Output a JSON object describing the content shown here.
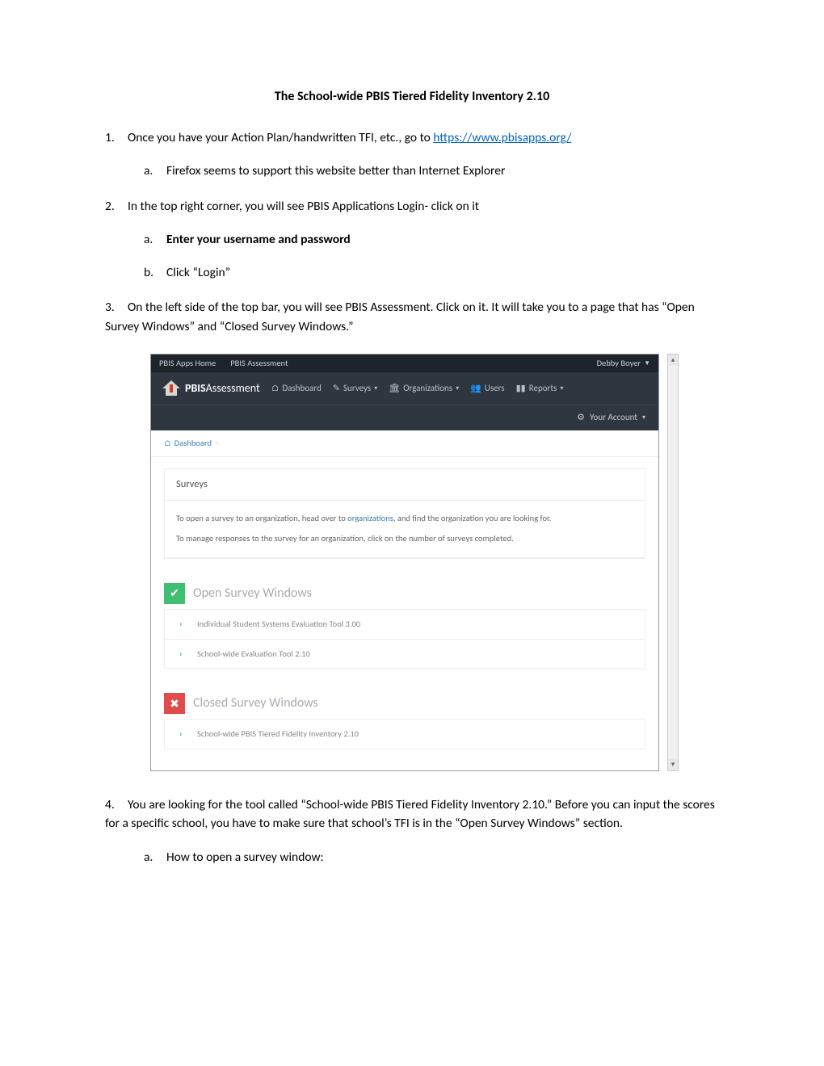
{
  "title": "The School-wide PBIS Tiered Fidelity Inventory 2.10",
  "steps": {
    "s1": {
      "num": "1.",
      "text_a": "Once you have your Action Plan/handwritten TFI, etc., go to ",
      "link": "https://www.pbisapps.org/"
    },
    "s1a": {
      "letter": "a.",
      "text": "Firefox seems to support this website better than Internet Explorer"
    },
    "s2": {
      "num": "2.",
      "text": "In the top right corner, you will see PBIS Applications Login- click on it"
    },
    "s2a": {
      "letter": "a.",
      "text": "Enter your username and password"
    },
    "s2b": {
      "letter": "b.",
      "text": "Click “Login”"
    },
    "s3": {
      "num": "3.",
      "text": "On the left side of the top bar, you will see PBIS Assessment. Click on it. It will take you to a page that has “Open Survey Windows” and “Closed Survey Windows.”"
    },
    "s4": {
      "num": "4.",
      "text": "You are looking for the tool called “School-wide PBIS Tiered Fidelity Inventory 2.10.” Before you can input the scores for a specific school, you have to make sure that school’s TFI is in the “Open Survey Windows” section."
    },
    "s4a": {
      "letter": "a.",
      "text": "How to open a survey window:"
    }
  },
  "shot": {
    "topbar": {
      "home": "PBIS Apps Home",
      "assessment": "PBIS Assessment",
      "user": "Debby Boyer"
    },
    "logo": {
      "bold": "PBIS",
      "light": "Assessment"
    },
    "nav": {
      "dashboard": "Dashboard",
      "surveys": "Surveys",
      "orgs": "Organizations",
      "users": "Users",
      "reports": "Reports",
      "account": "Your Account"
    },
    "crumb": "Dashboard",
    "panel": {
      "head": "Surveys",
      "line1a": "To open a survey to an organization, head over to ",
      "line1link": "organizations",
      "line1b": ", and find the organization you are looking for.",
      "line2": "To manage responses to the survey for an organization, click on the number of surveys completed."
    },
    "open": {
      "title": "Open Survey Windows",
      "rows": [
        "Individual Student Systems Evaluation Tool 3.00",
        "School-wide Evaluation Tool 2.10"
      ]
    },
    "closed": {
      "title": "Closed Survey Windows",
      "rows": [
        "School-wide PBIS Tiered Fidelity Inventory 2.10"
      ]
    }
  }
}
